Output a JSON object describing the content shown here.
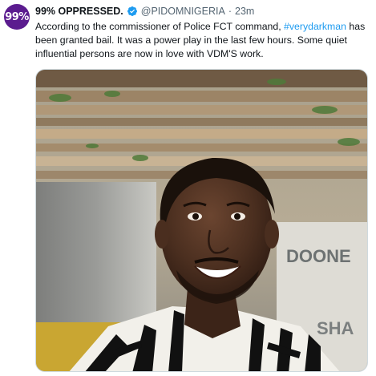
{
  "tweet": {
    "avatar_text": "99%",
    "display_name": "99% OPPRESSED.",
    "handle": "@PIDOMNIGERIA",
    "separator": "·",
    "timestamp": "23m",
    "text_part1": "According to the commissioner of Police FCT command, ",
    "hashtag": "#verydarkman",
    "text_part2": " has been granted bail. It was a power play in the last few hours. Some quiet influential persons are now in love with VDM'S work.",
    "media_alt": "Selfie photo of a smiling man in a zebra-print shirt under a wooden pergola",
    "background_sign_text": "DOONE",
    "background_sign_text2": "SHA"
  },
  "colors": {
    "avatar_bg": "#5b1c8f",
    "verified": "#1d9bf0",
    "hashtag": "#1d9bf0",
    "secondary_text": "#536471"
  },
  "icons": {
    "verified": "verified-badge-icon"
  }
}
